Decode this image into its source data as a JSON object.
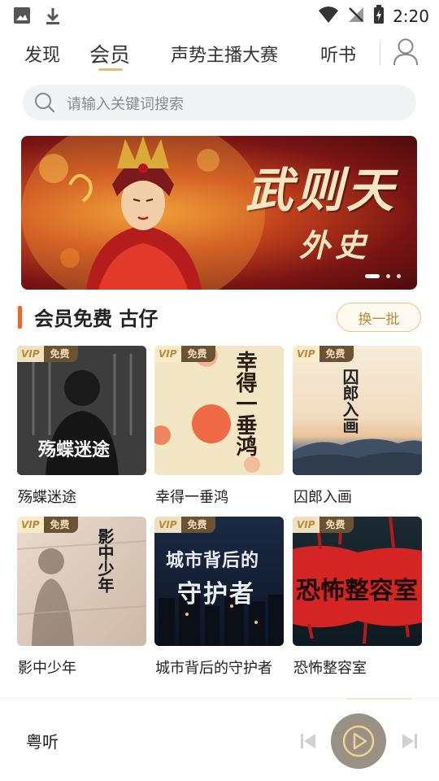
{
  "status_bar": {
    "time": "2:20",
    "left_icons": [
      "image-icon",
      "download-icon"
    ],
    "right_icons": [
      "wifi-icon",
      "no-signal-icon",
      "battery-charging-icon"
    ]
  },
  "nav": {
    "tabs": [
      {
        "label": "发现",
        "active": false
      },
      {
        "label": "会员",
        "active": true
      },
      {
        "label": "声势主播大赛",
        "active": false
      },
      {
        "label": "听书",
        "active": false
      }
    ],
    "accent_color": "#e7b96a",
    "user_icon": "user-icon"
  },
  "search": {
    "placeholder": "请输入关键词搜索",
    "icon": "search-icon"
  },
  "banner": {
    "title_main": "武则天",
    "title_sub": "外史",
    "slide_count": 3,
    "active_slide": 1
  },
  "section": {
    "title": "会员免费 古仔",
    "refresh_label": "换一批",
    "accent_color": "#f0651f"
  },
  "badge": {
    "vip": "VIP",
    "free": "免费"
  },
  "cards": [
    {
      "title": "殇蝶迷途",
      "cover_text": "殇蝶迷途"
    },
    {
      "title": "幸得一垂鸿",
      "cover_text": "幸得一垂鸿"
    },
    {
      "title": "囚郎入画",
      "cover_text": "囚郎入画"
    },
    {
      "title": "影中少年",
      "cover_text": "影中少年"
    },
    {
      "title": "城市背后的守护者",
      "cover_text_1": "城市背后的",
      "cover_text_2": "守护者"
    },
    {
      "title": "恐怖整容室",
      "cover_text": "恐怖整容室"
    }
  ],
  "player": {
    "title": "粤听",
    "controls": [
      "previous-icon",
      "play-icon",
      "next-icon"
    ]
  }
}
